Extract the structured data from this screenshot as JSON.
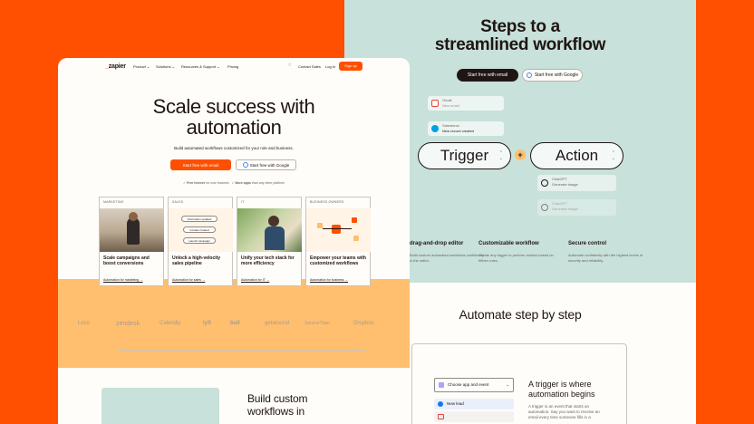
{
  "right": {
    "title_line1": "Steps to a",
    "title_line2": "streamlined workflow",
    "btn_email": "Start free with email",
    "btn_google": "Start free with Google",
    "steps": [
      {
        "label": "New email",
        "sub": "Gmail"
      },
      {
        "label": "New record created",
        "sub": "Salesforce"
      }
    ],
    "trigger": "Trigger",
    "action": "Action",
    "plus": "+",
    "action_steps": [
      {
        "label": "Generate image",
        "sub": "ChatGPT"
      },
      {
        "label": "Generate image",
        "sub": "ChatGPT"
      }
    ],
    "features": [
      {
        "title": "drag-and-drop editor",
        "desc": "Build custom automated workflows confidently in the editor."
      },
      {
        "title": "Customizable workflow",
        "desc": "Create any trigger to perform actions based on if/then rules."
      },
      {
        "title": "Secure control",
        "desc": "Automate confidently with the highest levels of security and reliability."
      }
    ],
    "subtitle": "Automate step by step",
    "app_event_placeholder": "Choose app and event",
    "app_items": [
      "New lead",
      ""
    ],
    "trigger_info_title": "A trigger is where automation begins",
    "trigger_info_desc": "A trigger is an event that starts an automation. Say you want to receive an email every time someone fills in a"
  },
  "left": {
    "logo": "zapier",
    "nav": [
      "Product ⌄",
      "Solutions ⌄",
      "Resources & Support ⌄",
      "Pricing"
    ],
    "contact": "Contact Sales",
    "login": "Log in",
    "signup": "Sign up",
    "hero_line1": "Scale success with",
    "hero_line2": "automation",
    "hero_sub": "Build automated workflows customized for your role and business.",
    "btn_email": "Start free with email",
    "btn_google": "Start free with Google",
    "check1_bold": "Free forever",
    "check1": "for core features",
    "check2_bold": "More apps",
    "check2": "than any other platform",
    "cards": [
      {
        "tag": "MARKETING",
        "title": "Scale campaigns and boost conversions",
        "link": "Automation for marketing →"
      },
      {
        "tag": "SALES",
        "title": "Unlock a high-velocity sales pipeline",
        "link": "Automation for sales →"
      },
      {
        "tag": "IT",
        "title": "Unify your tech stack for more efficiency",
        "link": "Automation for IT →"
      },
      {
        "tag": "BUSINESS OWNERS",
        "title": "Empower your teams with customized workflows",
        "link": "Automation for business →"
      }
    ],
    "sales_chips": [
      "Information updated",
      "Contact created",
      "Launch campaign"
    ],
    "logos": [
      "Loco",
      "zendesk",
      "Calendly",
      "lyft",
      "bull",
      "getaround",
      "ServiceTitan",
      "Dropbox"
    ],
    "build_title_1": "Build custom",
    "build_title_2": "workflows in"
  },
  "colors": {
    "orange": "#ff4f00",
    "peach": "#ffbf6e",
    "mint": "#c8e1da",
    "cream": "#fffdf9",
    "dark": "#201515"
  }
}
